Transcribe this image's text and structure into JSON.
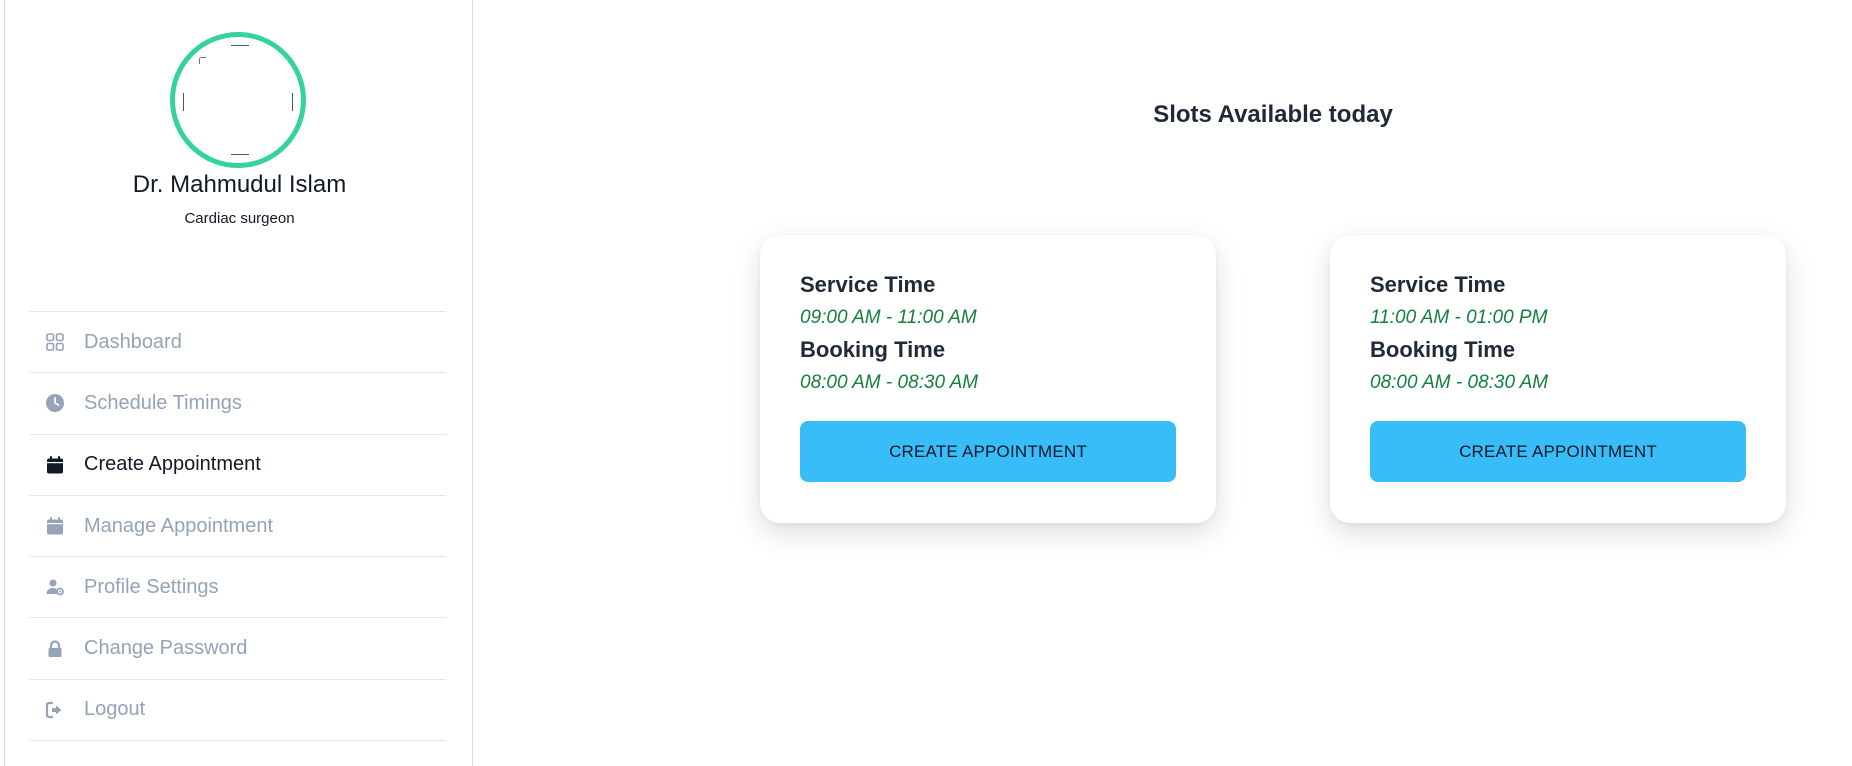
{
  "profile": {
    "name": "Dr. Mahmudul Islam",
    "title": "Cardiac surgeon"
  },
  "sidebar": {
    "items": [
      {
        "label": "Dashboard",
        "icon": "grid-icon",
        "active": false
      },
      {
        "label": "Schedule Timings",
        "icon": "clock-icon",
        "active": false
      },
      {
        "label": "Create Appointment",
        "icon": "calendar-icon",
        "active": true
      },
      {
        "label": "Manage Appointment",
        "icon": "calendar-icon",
        "active": false
      },
      {
        "label": "Profile Settings",
        "icon": "user-gear-icon",
        "active": false
      },
      {
        "label": "Change Password",
        "icon": "lock-icon",
        "active": false
      },
      {
        "label": "Logout",
        "icon": "sign-out-icon",
        "active": false
      }
    ]
  },
  "main": {
    "title": "Slots Available today",
    "slots": [
      {
        "service_label": "Service Time",
        "service_time": "09:00 AM - 11:00 AM",
        "booking_label": "Booking Time",
        "booking_time": "08:00 AM - 08:30 AM",
        "button_label": "CREATE APPOINTMENT"
      },
      {
        "service_label": "Service Time",
        "service_time": "11:00 AM - 01:00 PM",
        "booking_label": "Booking Time",
        "booking_time": "08:00 AM - 08:30 AM",
        "button_label": "CREATE APPOINTMENT"
      }
    ]
  },
  "colors": {
    "accent_ring": "#34d399",
    "button": "#38bdf8",
    "time_text": "#15803d",
    "inactive_menu": "#94a3b8"
  }
}
